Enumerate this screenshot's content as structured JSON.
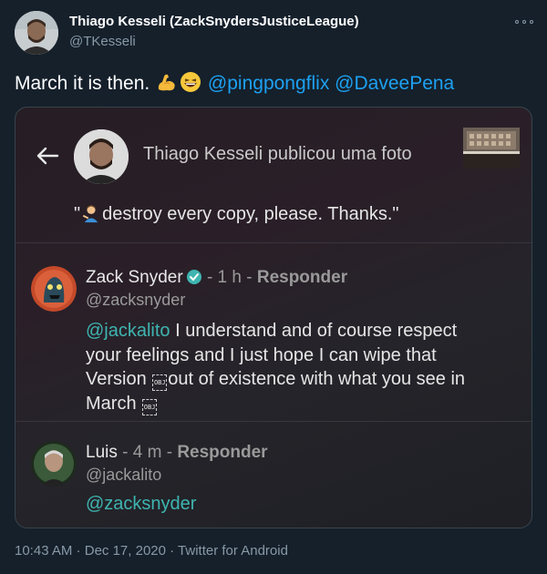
{
  "author": {
    "name": "Thiago Kesseli (ZackSnydersJusticeLeague)",
    "handle": "@TKesseli"
  },
  "tweet": {
    "text_prefix": "March it is then.",
    "emojis": [
      "flexed-biceps",
      "grinning-squinting-face"
    ],
    "mentions": [
      "@pingpongflix",
      "@DaveePena"
    ]
  },
  "media": {
    "header": "Thiago Kesseli publicou uma foto",
    "quote_prefix": "\"",
    "quote_text": "destroy every copy, please. Thanks.\"",
    "comments": [
      {
        "name": "Zack Snyder",
        "verified": true,
        "time": "- 1 h -",
        "reply_label": "Responder",
        "handle": "@zacksnyder",
        "mention": "@jackalito",
        "text_line1": " I understand and of course respect",
        "text_line2": "your feelings and I just hope I can wipe that",
        "text_line3a": "Version ",
        "text_line3b": "out of existence with what you see in",
        "text_line4": "March ",
        "obj_label": "OBJ"
      },
      {
        "name": "Luis",
        "time": "- 4 m -",
        "reply_label": "Responder",
        "handle": "@jackalito",
        "text": "@zacksnyder"
      }
    ]
  },
  "footer": {
    "time": "10:43 AM",
    "sep1": " · ",
    "date": "Dec 17, 2020",
    "sep2": " · ",
    "source": "Twitter for Android"
  },
  "colors": {
    "background": "#15202b",
    "mention": "#1da1f2",
    "secondary": "#8899a6",
    "app_mention": "#3eb5b0"
  }
}
